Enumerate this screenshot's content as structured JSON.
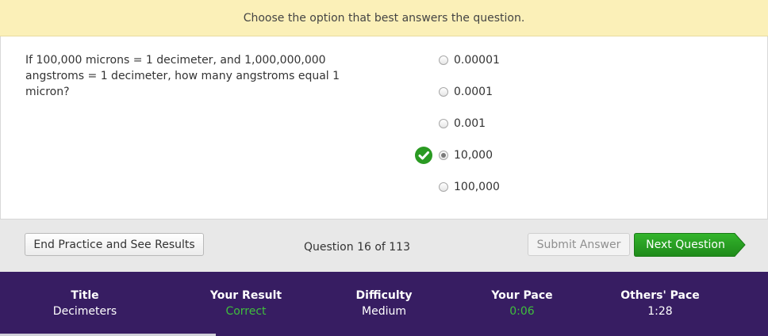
{
  "instruction": "Choose the option that best answers the question.",
  "question": {
    "text": "If 100,000 microns = 1 decimeter, and 1,000,000,000 angstroms = 1 decimeter, how many angstroms equal 1 micron?"
  },
  "choices": [
    {
      "label": "0.00001",
      "selected": false
    },
    {
      "label": "0.0001",
      "selected": false
    },
    {
      "label": "0.001",
      "selected": false
    },
    {
      "label": "10,000",
      "selected": true
    },
    {
      "label": "100,000",
      "selected": false
    }
  ],
  "actions": {
    "end_label": "End Practice and See Results",
    "counter": "Question 16 of 113",
    "submit_label": "Submit Answer",
    "next_label": "Next Question"
  },
  "stats": {
    "title": {
      "label": "Title",
      "value": "Decimeters"
    },
    "result": {
      "label": "Your Result",
      "value": "Correct"
    },
    "difficulty": {
      "label": "Difficulty",
      "value": "Medium"
    },
    "your_pace": {
      "label": "Your Pace",
      "value": "0:06"
    },
    "others_pace": {
      "label": "Others' Pace",
      "value": "1:28"
    }
  },
  "colors": {
    "instruction_bg": "#fbf0b8",
    "stats_bg": "#371d62",
    "accent_green": "#2a9a22",
    "stat_green": "#3fbf3c"
  },
  "icons": [
    "check-icon",
    "arrow-shape"
  ]
}
